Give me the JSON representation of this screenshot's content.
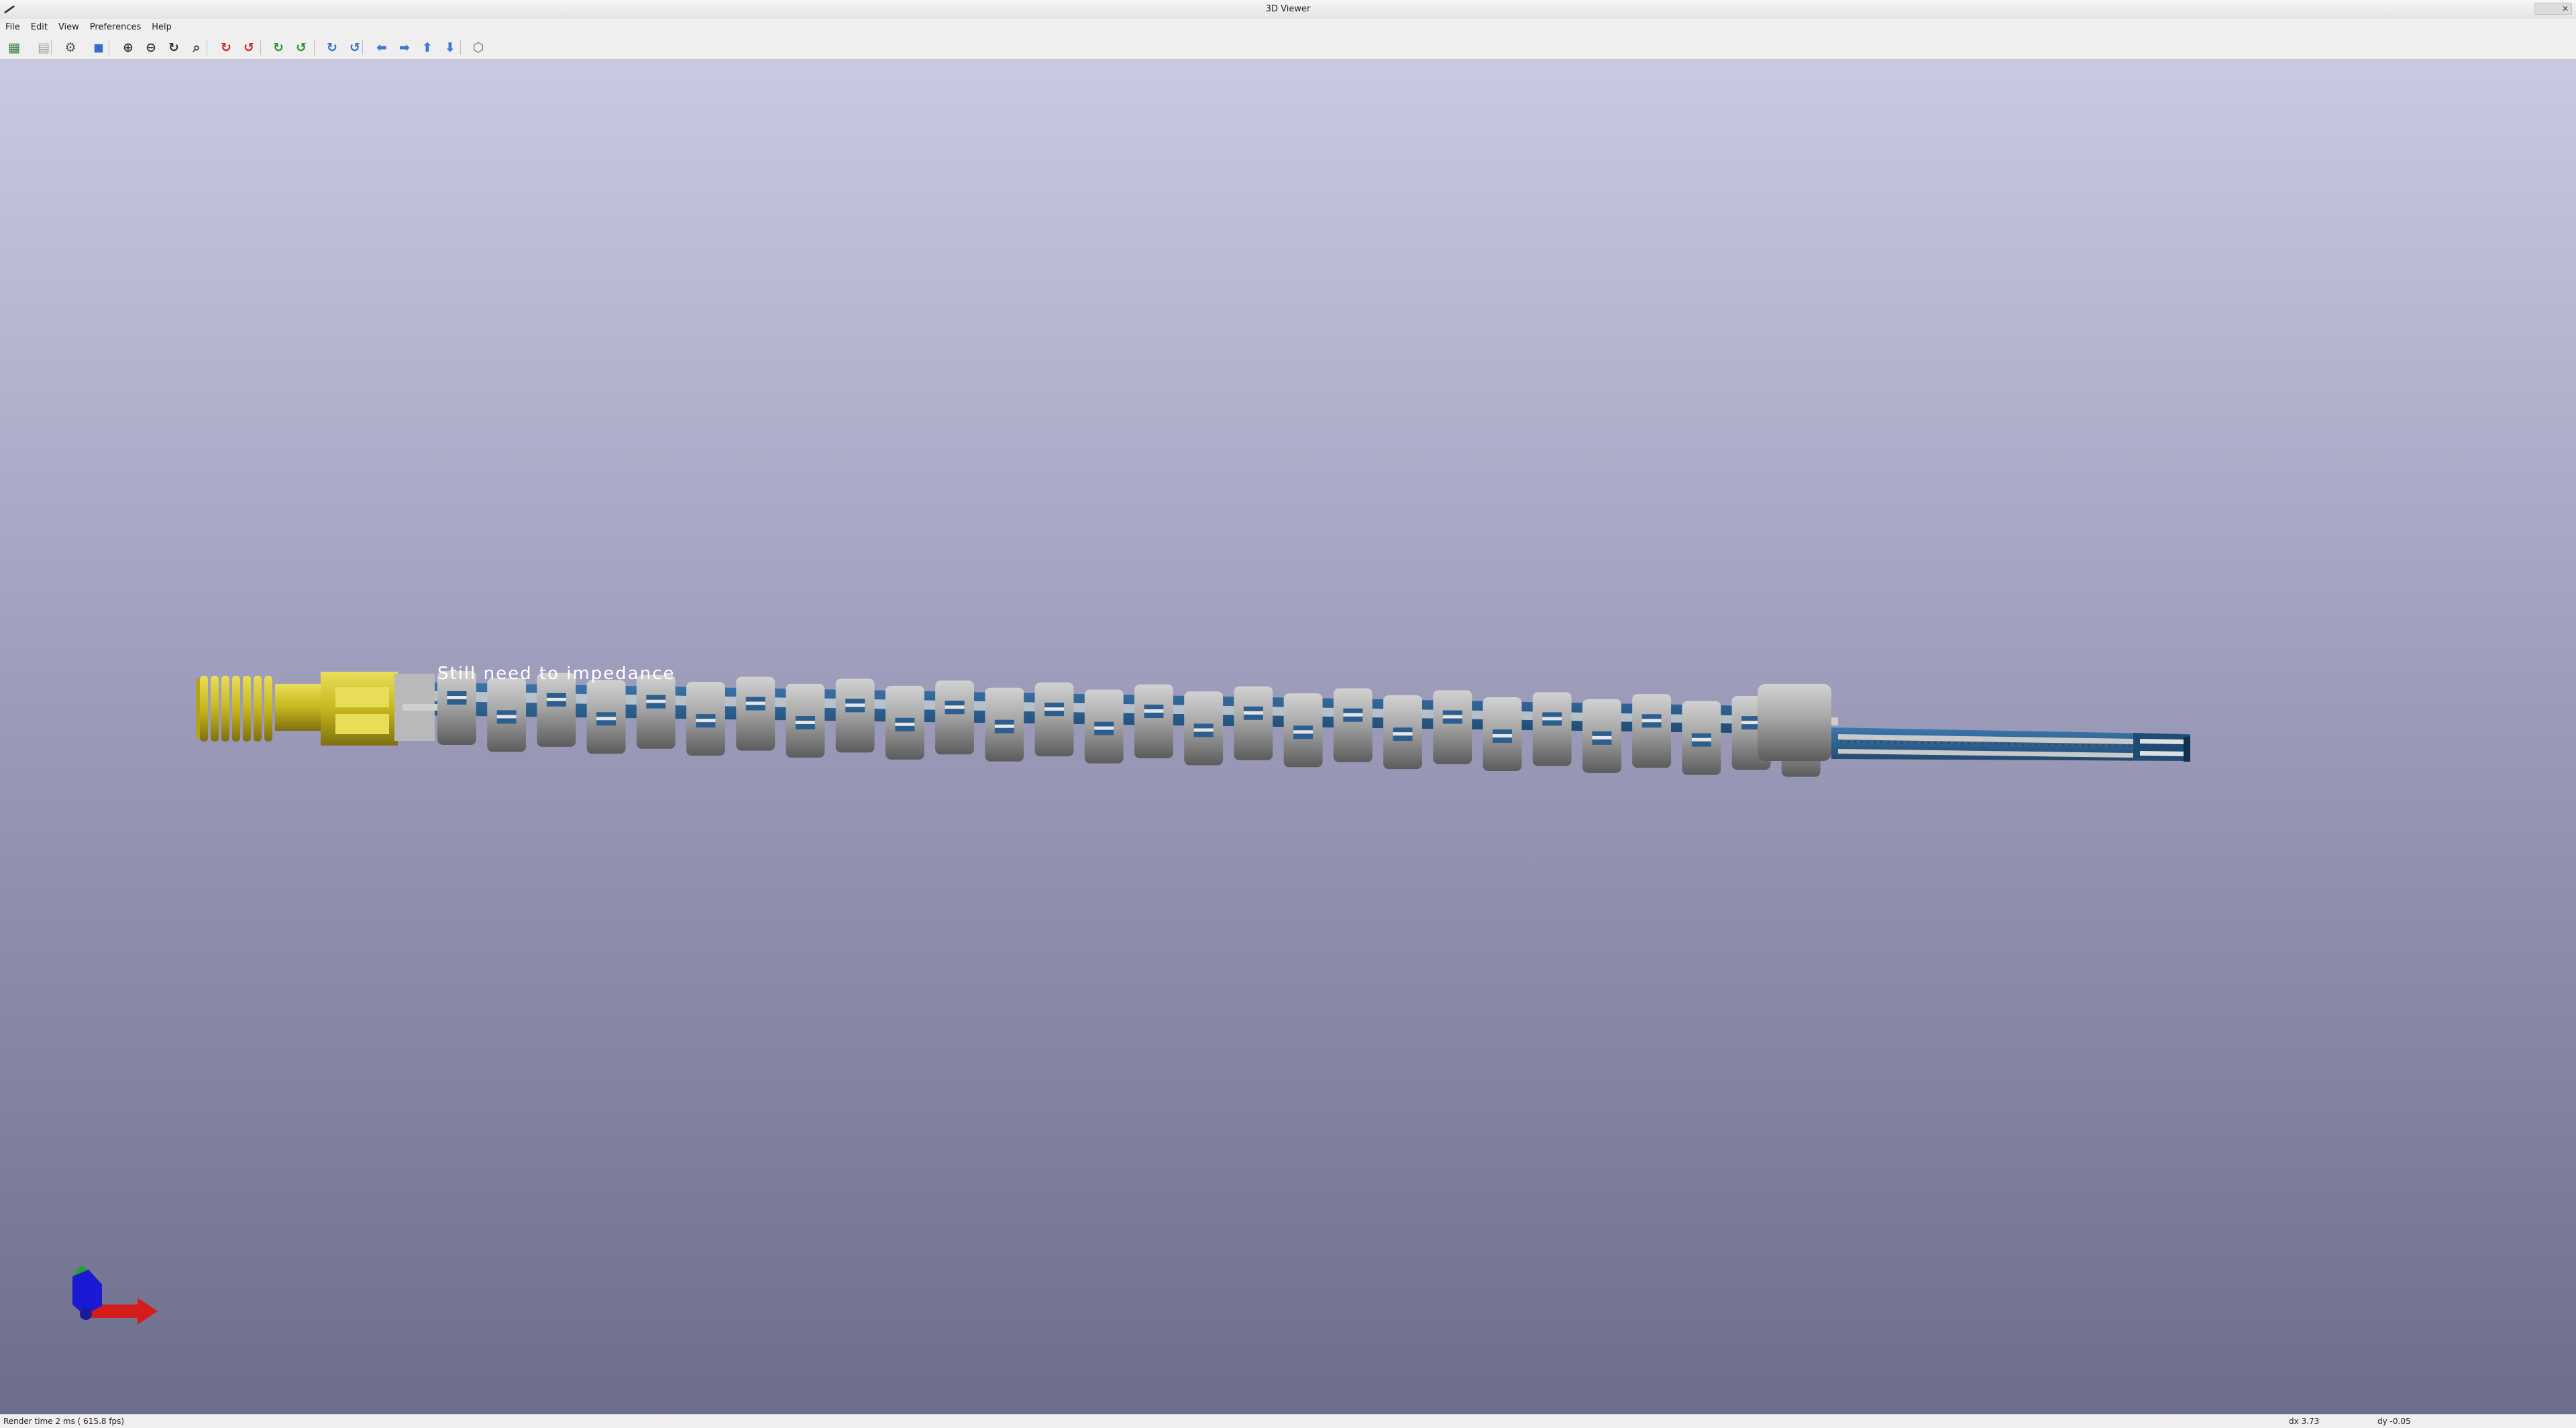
{
  "window": {
    "title": "3D Viewer"
  },
  "menu": {
    "items": [
      "File",
      "Edit",
      "View",
      "Preferences",
      "Help"
    ]
  },
  "toolbar": {
    "buttons": [
      {
        "name": "update-pcb-button",
        "glyph": "▦",
        "color": "#2d7a3a"
      },
      {
        "name": "copy-image-button",
        "glyph": "▤",
        "color": "#a0a0a0"
      },
      {
        "name": "preferences-button",
        "glyph": "⚙",
        "color": "#555555"
      },
      {
        "name": "raytracing-button",
        "glyph": "◼",
        "color": "#2f6fc7"
      },
      {
        "name": "zoom-in-button",
        "glyph": "⊕",
        "color": "#333333"
      },
      {
        "name": "zoom-out-button",
        "glyph": "⊖",
        "color": "#333333"
      },
      {
        "name": "redraw-button",
        "glyph": "↻",
        "color": "#333333"
      },
      {
        "name": "zoom-fit-button",
        "glyph": "⌕",
        "color": "#333333"
      },
      {
        "name": "rotate-x-cw-button",
        "glyph": "↻",
        "color": "#d02020"
      },
      {
        "name": "rotate-x-ccw-button",
        "glyph": "↺",
        "color": "#d02020"
      },
      {
        "name": "rotate-y-cw-button",
        "glyph": "↻",
        "color": "#1f9a2b"
      },
      {
        "name": "rotate-y-ccw-button",
        "glyph": "↺",
        "color": "#1f9a2b"
      },
      {
        "name": "rotate-z-cw-button",
        "glyph": "↻",
        "color": "#2f6fc7"
      },
      {
        "name": "rotate-z-ccw-button",
        "glyph": "↺",
        "color": "#2f6fc7"
      },
      {
        "name": "move-left-button",
        "glyph": "⬅",
        "color": "#3b78d6"
      },
      {
        "name": "move-right-button",
        "glyph": "➡",
        "color": "#3b78d6"
      },
      {
        "name": "move-up-button",
        "glyph": "⬆",
        "color": "#3b78d6"
      },
      {
        "name": "move-down-button",
        "glyph": "⬇",
        "color": "#3b78d6"
      },
      {
        "name": "ortho-toggle-button",
        "glyph": "⬡",
        "color": "#666666"
      }
    ]
  },
  "scene": {
    "annotation": "Still need to impedance",
    "connector_color": "#c8b820",
    "cylinder_color": "#9a9a9a",
    "board_color": "#2d5f8e"
  },
  "status": {
    "render_time": "Render time 2 ms ( 615.8 fps)",
    "dx": "dx 3.73",
    "dy": "dy -0.05"
  }
}
